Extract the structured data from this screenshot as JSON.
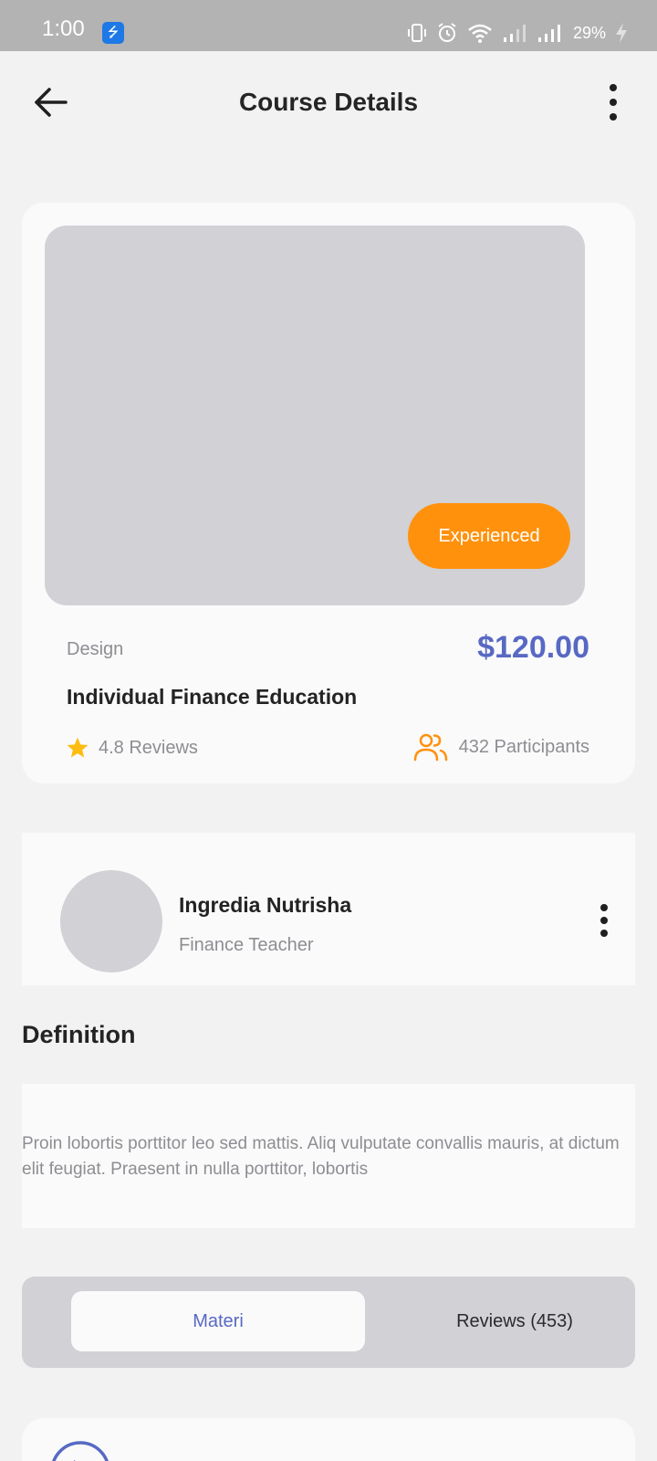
{
  "status_bar": {
    "time": "1:00",
    "battery": "29%",
    "icons": [
      "usb-icon",
      "vibrate-icon",
      "alarm-icon",
      "wifi-icon",
      "signal-icon",
      "signal-icon",
      "charging-icon"
    ]
  },
  "header": {
    "title": "Course Details",
    "back_icon": "arrow-left-icon",
    "menu_icon": "more-vertical-icon"
  },
  "course": {
    "badge": "Experienced",
    "category": "Design",
    "price": "$120.00",
    "name": "Individual Finance Education",
    "rating": "4.8 Reviews",
    "participants": "432 Participants"
  },
  "teacher": {
    "name": "Ingredia Nutrisha",
    "role": "Finance Teacher"
  },
  "definition": {
    "title": "Definition",
    "text": "Proin lobortis porttitor leo sed mattis. Aliq vulputate convallis mauris, at dictum elit feugiat. Praesent in nulla porttitor, lobortis"
  },
  "tabs": [
    {
      "label": "Materi",
      "active": true
    },
    {
      "label": "Reviews (453)",
      "active": false
    }
  ],
  "colors": {
    "accent": "#5869c4",
    "badge": "#ff910c",
    "star": "#fcbd0f",
    "placeholder": "#d1d1d6"
  }
}
